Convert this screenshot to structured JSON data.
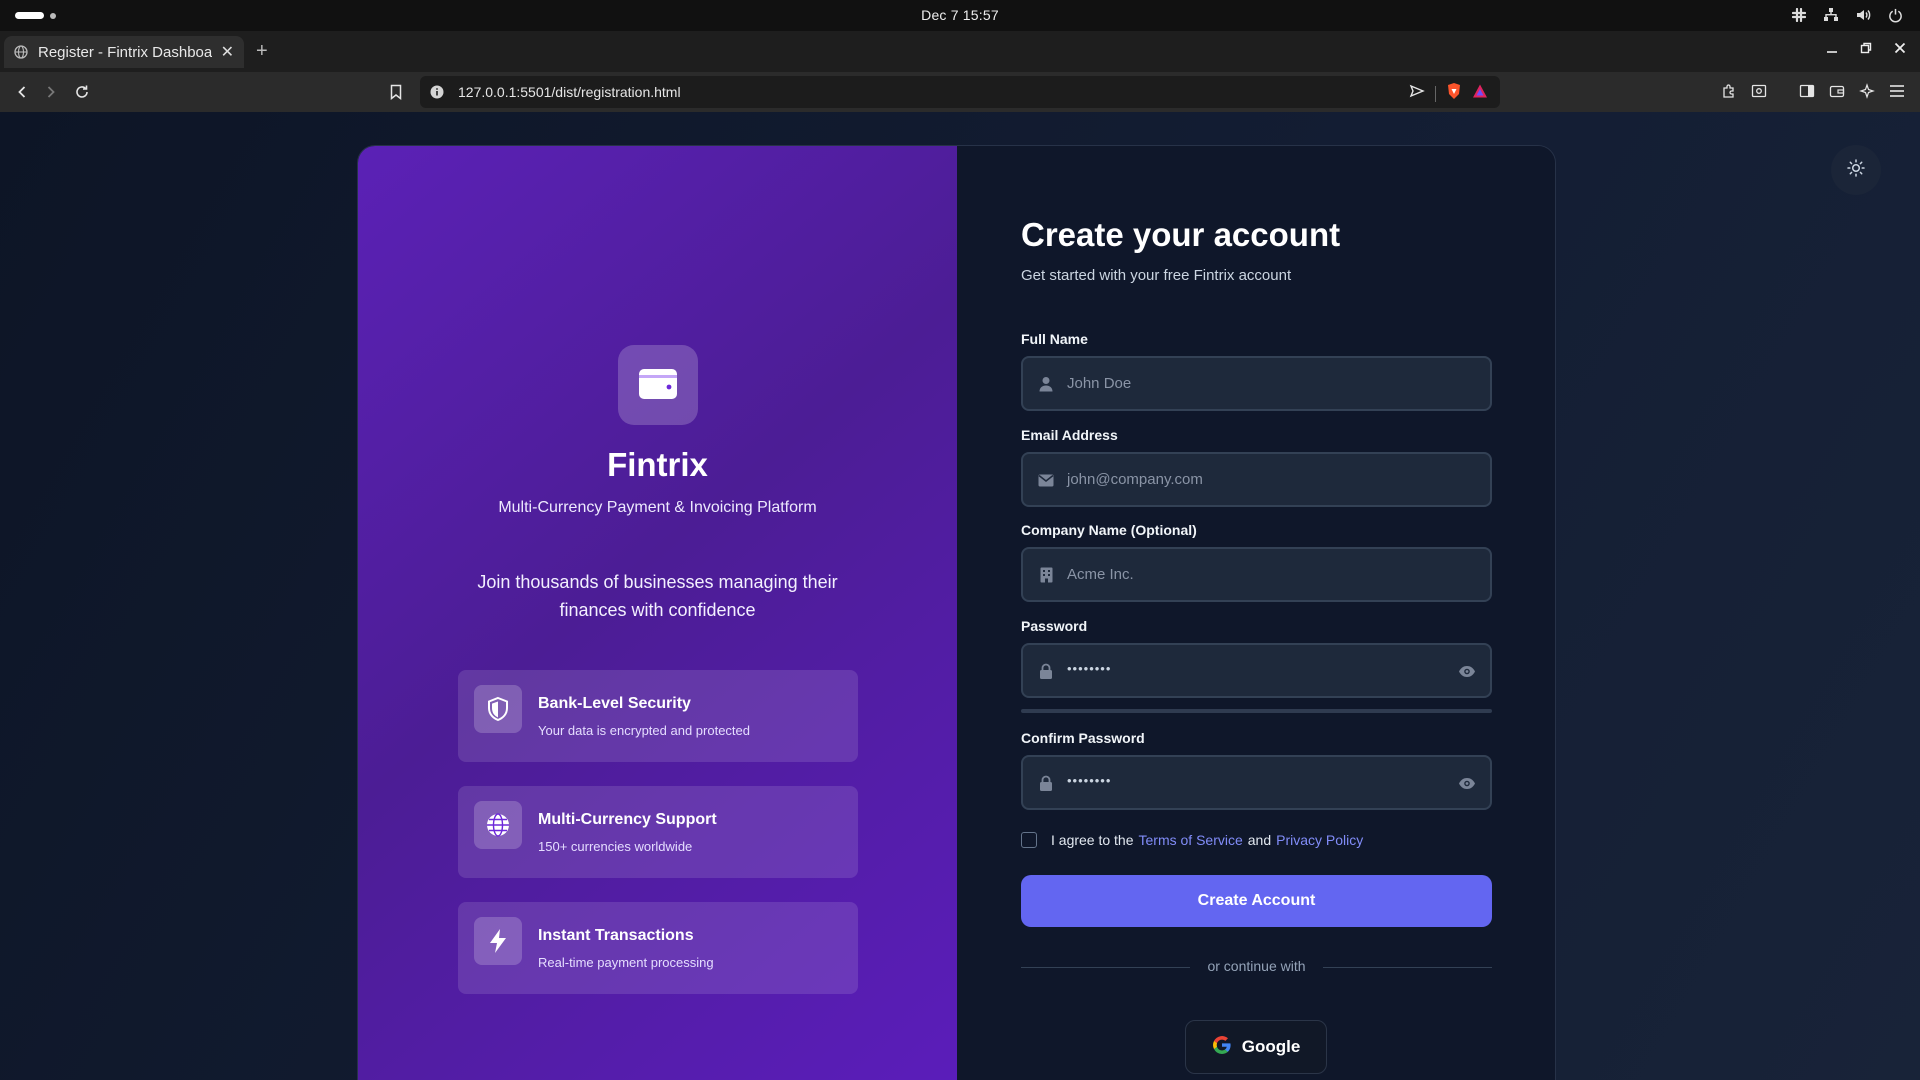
{
  "os": {
    "clock": "Dec 7  15:57"
  },
  "browser": {
    "tab_title": "Register - Fintrix Dashboard",
    "tab_close": "✕",
    "new_tab": "+",
    "url": "127.0.0.1:5501/dist/registration.html"
  },
  "brand_panel": {
    "name": "Fintrix",
    "tagline": "Multi-Currency Payment & Invoicing Platform",
    "pitch": "Join thousands of businesses managing their finances with confidence",
    "features": [
      {
        "icon": "shield-icon",
        "title": "Bank-Level Security",
        "description": "Your data is encrypted and protected"
      },
      {
        "icon": "globe-icon",
        "title": "Multi-Currency Support",
        "description": "150+ currencies worldwide"
      },
      {
        "icon": "lightning-icon",
        "title": "Instant Transactions",
        "description": "Real-time payment processing"
      }
    ]
  },
  "form": {
    "title": "Create your account",
    "subtitle": "Get started with your free Fintrix account",
    "full_name": {
      "label": "Full Name",
      "placeholder": "John Doe"
    },
    "email": {
      "label": "Email Address",
      "placeholder": "john@company.com"
    },
    "company": {
      "label": "Company Name (Optional)",
      "placeholder": "Acme Inc."
    },
    "password": {
      "label": "Password",
      "placeholder": "••••••••"
    },
    "confirm_password": {
      "label": "Confirm Password",
      "placeholder": "••••••••"
    },
    "terms": {
      "prefix": "I agree to the",
      "terms_link": "Terms of Service",
      "and": "and",
      "privacy_link": "Privacy Policy"
    },
    "submit_label": "Create Account",
    "divider_text": "or continue with",
    "google_label": "Google"
  },
  "colors": {
    "accent": "#6366f1",
    "brand_panel": "#5b21b6",
    "link": "#818cf8",
    "background": "#0f172a"
  }
}
